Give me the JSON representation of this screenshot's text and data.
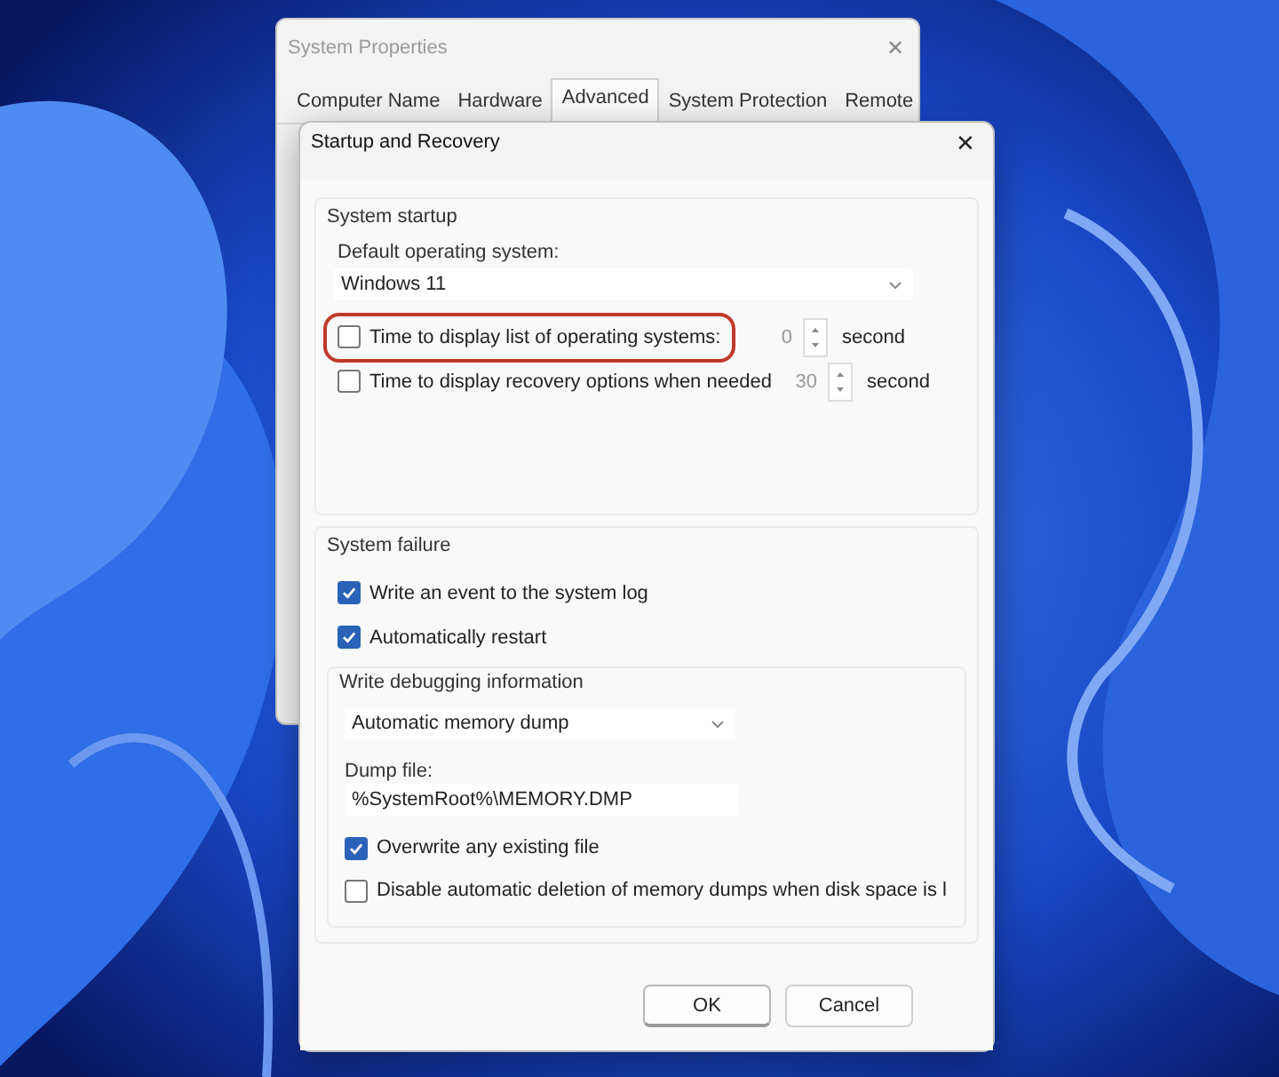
{
  "background_window": {
    "title": "System Properties",
    "close": "✕",
    "tabs": [
      {
        "label": "Computer Name",
        "selected": false
      },
      {
        "label": "Hardware",
        "selected": false
      },
      {
        "label": "Advanced",
        "selected": true
      },
      {
        "label": "System Protection",
        "selected": false
      },
      {
        "label": "Remote",
        "selected": false
      }
    ]
  },
  "dialog": {
    "title": "Startup and Recovery",
    "close": "✕",
    "system_startup": {
      "heading": "System startup",
      "default_os_label": "Default operating system:",
      "default_os": "Windows 11",
      "options": [
        {
          "label": "Time to display list of operating systems:",
          "checked": false,
          "highlighted": true,
          "value": "0",
          "unit": "second"
        },
        {
          "label": "Time to display recovery options when needed",
          "checked": false,
          "highlighted": false,
          "value": "30",
          "unit": "second"
        }
      ]
    },
    "system_failure": {
      "heading": "System failure",
      "options": [
        {
          "label": "Write an event to the system log",
          "checked": true
        },
        {
          "label": "Automatically restart",
          "checked": true
        }
      ],
      "debugging": {
        "heading": "Write debugging information",
        "dump_type": "Automatic memory dump",
        "dump_file_label": "Dump file:",
        "dump_file": "%SystemRoot%\\MEMORY.DMP",
        "options": [
          {
            "label": "Overwrite any existing file",
            "checked": true
          },
          {
            "label": "Disable automatic deletion of memory dumps when disk space is l",
            "checked": false
          }
        ]
      }
    },
    "buttons": [
      {
        "label": "OK",
        "kind": "default"
      },
      {
        "label": "Cancel",
        "kind": "normal"
      }
    ]
  }
}
